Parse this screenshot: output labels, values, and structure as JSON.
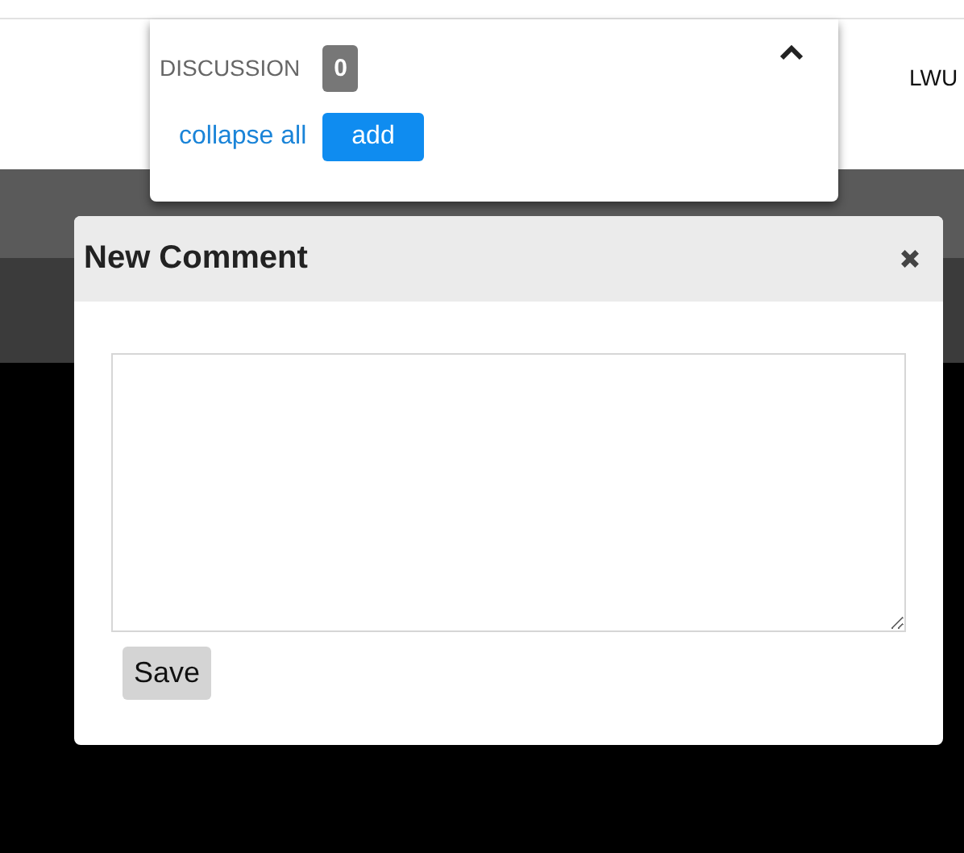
{
  "discussion": {
    "title": "DISCUSSION",
    "count": "0",
    "expanded": true,
    "links": [
      "collapse all"
    ],
    "add_button": "add"
  },
  "header_right": {
    "label": "LWU"
  },
  "dialog": {
    "title": "New Comment",
    "save_button": "Save"
  }
}
